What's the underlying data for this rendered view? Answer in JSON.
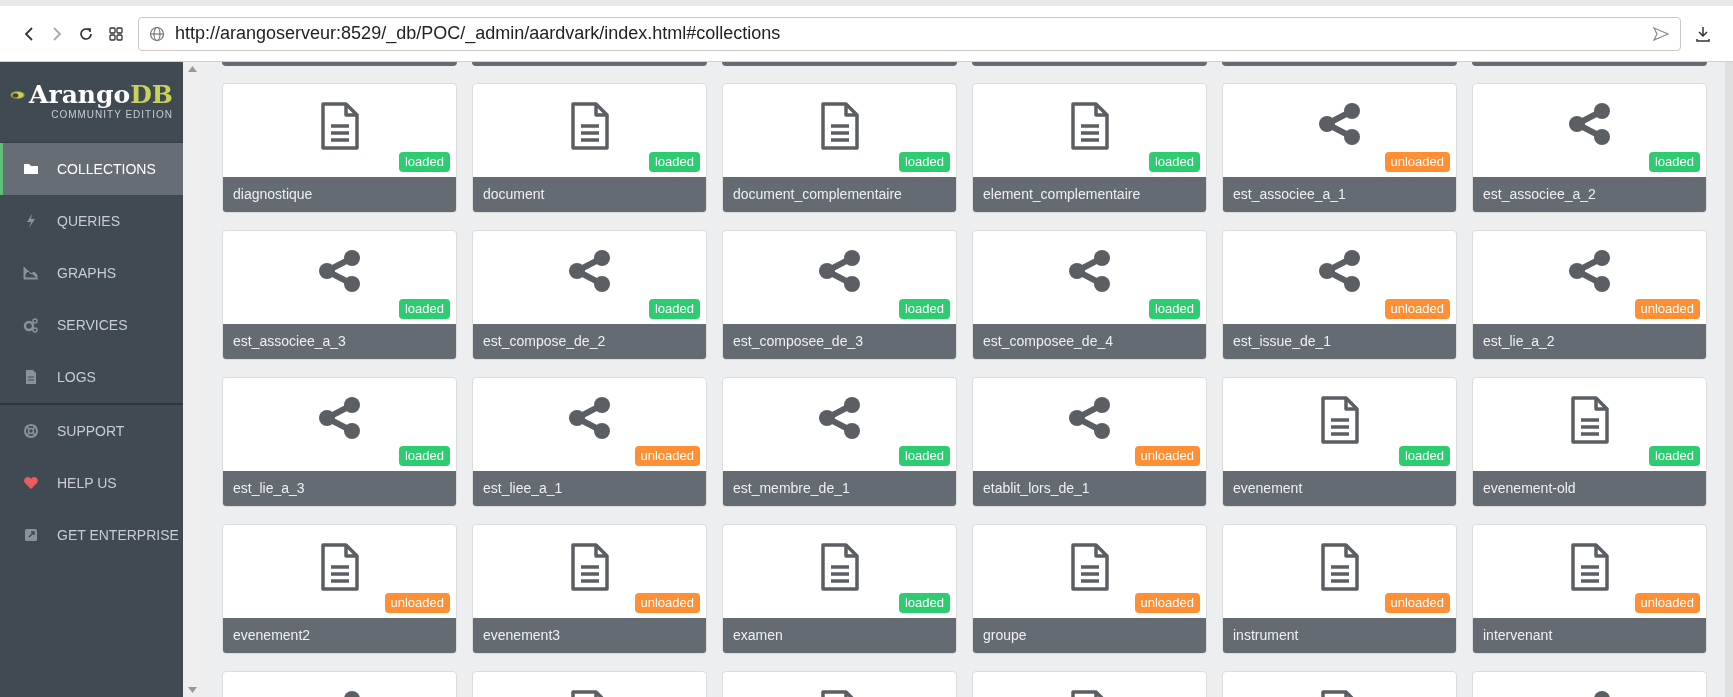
{
  "browser": {
    "url": "http://arangoserveur:8529/_db/POC/_admin/aardvark/index.html#collections"
  },
  "logo": {
    "name_main": "Arango",
    "name_accent": "DB",
    "edition": "COMMUNITY EDITION"
  },
  "sidebar": {
    "items": [
      {
        "label": "COLLECTIONS",
        "kind": "folder",
        "selected": true
      },
      {
        "label": "QUERIES",
        "kind": "bolt",
        "selected": false
      },
      {
        "label": "GRAPHS",
        "kind": "chart",
        "selected": false
      },
      {
        "label": "SERVICES",
        "kind": "gears",
        "selected": false
      },
      {
        "label": "LOGS",
        "kind": "file",
        "selected": false
      },
      {
        "label": "SUPPORT",
        "kind": "lifebuoy",
        "selected": false
      },
      {
        "label": "HELP US",
        "kind": "heart",
        "selected": false
      },
      {
        "label": "GET ENTERPRISE",
        "kind": "external",
        "selected": false
      }
    ]
  },
  "collections": [
    {
      "name": "diagnostique",
      "kind": "document",
      "status": "loaded"
    },
    {
      "name": "document",
      "kind": "document",
      "status": "loaded"
    },
    {
      "name": "document_complementaire",
      "kind": "document",
      "status": "loaded"
    },
    {
      "name": "element_complementaire",
      "kind": "document",
      "status": "loaded"
    },
    {
      "name": "est_associee_a_1",
      "kind": "edge",
      "status": "unloaded"
    },
    {
      "name": "est_associee_a_2",
      "kind": "edge",
      "status": "loaded"
    },
    {
      "name": "est_associee_a_3",
      "kind": "edge",
      "status": "loaded"
    },
    {
      "name": "est_compose_de_2",
      "kind": "edge",
      "status": "loaded"
    },
    {
      "name": "est_composee_de_3",
      "kind": "edge",
      "status": "loaded"
    },
    {
      "name": "est_composee_de_4",
      "kind": "edge",
      "status": "loaded"
    },
    {
      "name": "est_issue_de_1",
      "kind": "edge",
      "status": "unloaded"
    },
    {
      "name": "est_lie_a_2",
      "kind": "edge",
      "status": "unloaded"
    },
    {
      "name": "est_lie_a_3",
      "kind": "edge",
      "status": "loaded"
    },
    {
      "name": "est_liee_a_1",
      "kind": "edge",
      "status": "unloaded"
    },
    {
      "name": "est_membre_de_1",
      "kind": "edge",
      "status": "loaded"
    },
    {
      "name": "etablit_lors_de_1",
      "kind": "edge",
      "status": "unloaded"
    },
    {
      "name": "evenement",
      "kind": "document",
      "status": "loaded"
    },
    {
      "name": "evenement-old",
      "kind": "document",
      "status": "loaded"
    },
    {
      "name": "evenement2",
      "kind": "document",
      "status": "unloaded"
    },
    {
      "name": "evenement3",
      "kind": "document",
      "status": "unloaded"
    },
    {
      "name": "examen",
      "kind": "document",
      "status": "loaded"
    },
    {
      "name": "groupe",
      "kind": "document",
      "status": "unloaded"
    },
    {
      "name": "instrument",
      "kind": "document",
      "status": "unloaded"
    },
    {
      "name": "intervenant",
      "kind": "document",
      "status": "unloaded"
    },
    {
      "kind": "edge"
    },
    {
      "kind": "document"
    },
    {
      "kind": "document"
    },
    {
      "kind": "document"
    },
    {
      "kind": "document"
    },
    {
      "kind": "edge"
    }
  ]
}
